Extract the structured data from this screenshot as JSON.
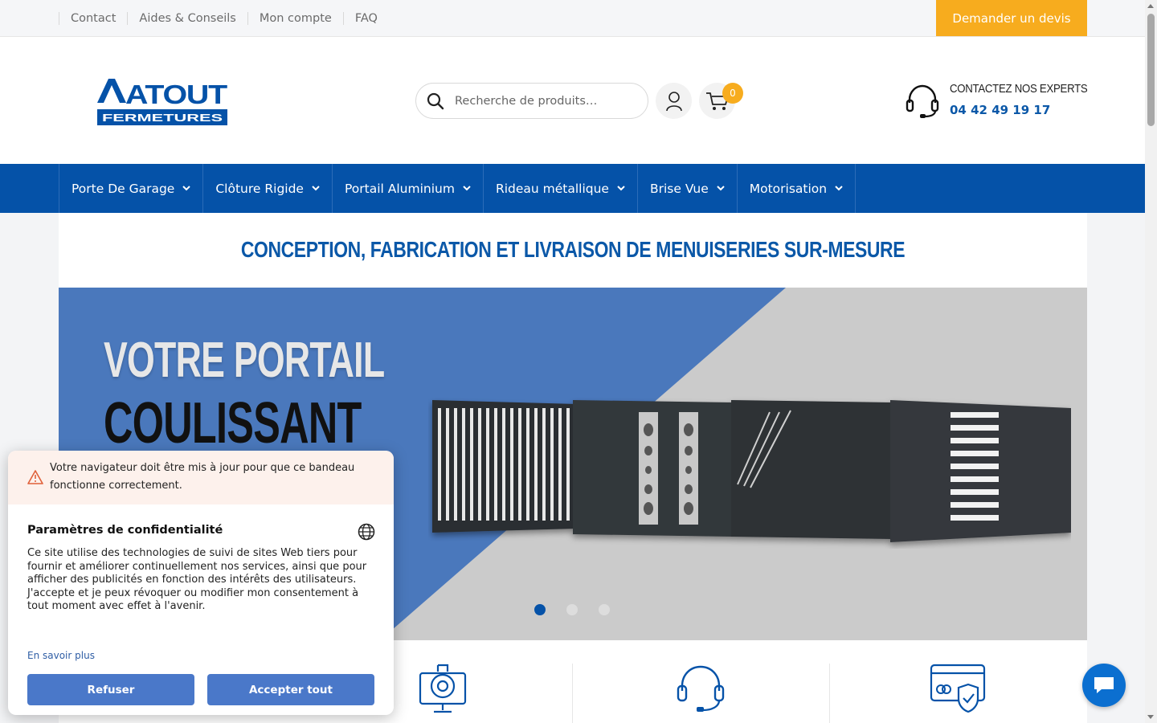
{
  "topbar": {
    "links": [
      "Contact",
      "Aides & Conseils",
      "Mon compte",
      "FAQ"
    ],
    "quote_button": "Demander un devis"
  },
  "header": {
    "logo_top": "ATOUT",
    "logo_bottom": "FERMETURES",
    "search_placeholder": "Recherche de produits…",
    "cart_count": "0",
    "contact_label": "CONTACTEZ NOS EXPERTS",
    "contact_phone": "04 42 49 19 17"
  },
  "nav": {
    "items": [
      "Porte De Garage",
      "Clôture Rigide",
      "Portail Aluminium",
      "Rideau métallique",
      "Brise Vue",
      "Motorisation"
    ]
  },
  "main": {
    "tagline": "CONCEPTION, FABRICATION ET LIVRAISON DE MENUISERIES SUR-MESURE",
    "banner_line1": "VOTRE PORTAIL",
    "banner_line2": "COULISSANT",
    "slides_total": 3,
    "slide_active": 1
  },
  "consent": {
    "warning": "Votre navigateur doit être mis à jour pour que ce bandeau fonctionne correctement.",
    "title": "Paramètres de confidentialité",
    "body": "Ce site utilise des technologies de suivi de sites Web tiers pour fournir et améliorer continuellement nos services, ainsi que pour afficher des publicités en fonction des intérêts des utilisateurs. J'accepte et je peux révoquer ou modifier mon consentement à tout moment avec effet à l'avenir.",
    "learn_more": "En savoir plus",
    "refuse": "Refuser",
    "accept": "Accepter tout"
  },
  "colors": {
    "brand_blue": "#0552a8",
    "accent_orange": "#f7ac1e",
    "consent_button": "#4a78c9"
  },
  "icons": [
    "search-icon",
    "user-icon",
    "cart-icon",
    "headset-icon",
    "chevron-down-icon",
    "warning-icon",
    "globe-icon",
    "chat-icon",
    "gear-monitor-icon",
    "headset-support-icon",
    "secure-payment-icon"
  ]
}
